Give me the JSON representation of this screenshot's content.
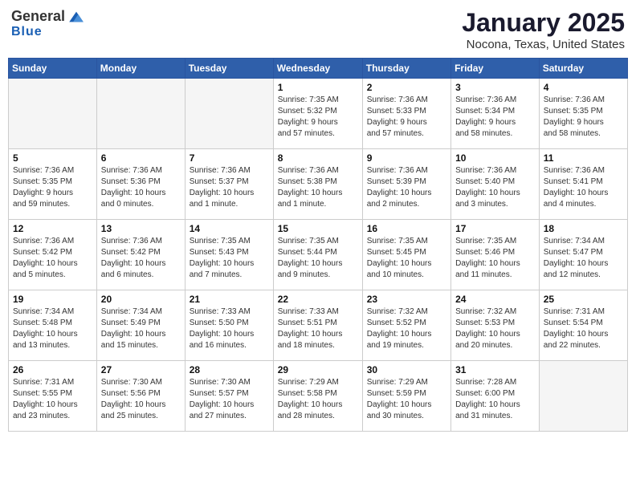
{
  "logo": {
    "general": "General",
    "blue": "Blue",
    "tagline": "Blue"
  },
  "header": {
    "title": "January 2025",
    "subtitle": "Nocona, Texas, United States"
  },
  "days_of_week": [
    "Sunday",
    "Monday",
    "Tuesday",
    "Wednesday",
    "Thursday",
    "Friday",
    "Saturday"
  ],
  "weeks": [
    [
      {
        "day": "",
        "info": ""
      },
      {
        "day": "",
        "info": ""
      },
      {
        "day": "",
        "info": ""
      },
      {
        "day": "1",
        "info": "Sunrise: 7:35 AM\nSunset: 5:32 PM\nDaylight: 9 hours\nand 57 minutes."
      },
      {
        "day": "2",
        "info": "Sunrise: 7:36 AM\nSunset: 5:33 PM\nDaylight: 9 hours\nand 57 minutes."
      },
      {
        "day": "3",
        "info": "Sunrise: 7:36 AM\nSunset: 5:34 PM\nDaylight: 9 hours\nand 58 minutes."
      },
      {
        "day": "4",
        "info": "Sunrise: 7:36 AM\nSunset: 5:35 PM\nDaylight: 9 hours\nand 58 minutes."
      }
    ],
    [
      {
        "day": "5",
        "info": "Sunrise: 7:36 AM\nSunset: 5:35 PM\nDaylight: 9 hours\nand 59 minutes."
      },
      {
        "day": "6",
        "info": "Sunrise: 7:36 AM\nSunset: 5:36 PM\nDaylight: 10 hours\nand 0 minutes."
      },
      {
        "day": "7",
        "info": "Sunrise: 7:36 AM\nSunset: 5:37 PM\nDaylight: 10 hours\nand 1 minute."
      },
      {
        "day": "8",
        "info": "Sunrise: 7:36 AM\nSunset: 5:38 PM\nDaylight: 10 hours\nand 1 minute."
      },
      {
        "day": "9",
        "info": "Sunrise: 7:36 AM\nSunset: 5:39 PM\nDaylight: 10 hours\nand 2 minutes."
      },
      {
        "day": "10",
        "info": "Sunrise: 7:36 AM\nSunset: 5:40 PM\nDaylight: 10 hours\nand 3 minutes."
      },
      {
        "day": "11",
        "info": "Sunrise: 7:36 AM\nSunset: 5:41 PM\nDaylight: 10 hours\nand 4 minutes."
      }
    ],
    [
      {
        "day": "12",
        "info": "Sunrise: 7:36 AM\nSunset: 5:42 PM\nDaylight: 10 hours\nand 5 minutes."
      },
      {
        "day": "13",
        "info": "Sunrise: 7:36 AM\nSunset: 5:42 PM\nDaylight: 10 hours\nand 6 minutes."
      },
      {
        "day": "14",
        "info": "Sunrise: 7:35 AM\nSunset: 5:43 PM\nDaylight: 10 hours\nand 7 minutes."
      },
      {
        "day": "15",
        "info": "Sunrise: 7:35 AM\nSunset: 5:44 PM\nDaylight: 10 hours\nand 9 minutes."
      },
      {
        "day": "16",
        "info": "Sunrise: 7:35 AM\nSunset: 5:45 PM\nDaylight: 10 hours\nand 10 minutes."
      },
      {
        "day": "17",
        "info": "Sunrise: 7:35 AM\nSunset: 5:46 PM\nDaylight: 10 hours\nand 11 minutes."
      },
      {
        "day": "18",
        "info": "Sunrise: 7:34 AM\nSunset: 5:47 PM\nDaylight: 10 hours\nand 12 minutes."
      }
    ],
    [
      {
        "day": "19",
        "info": "Sunrise: 7:34 AM\nSunset: 5:48 PM\nDaylight: 10 hours\nand 13 minutes."
      },
      {
        "day": "20",
        "info": "Sunrise: 7:34 AM\nSunset: 5:49 PM\nDaylight: 10 hours\nand 15 minutes."
      },
      {
        "day": "21",
        "info": "Sunrise: 7:33 AM\nSunset: 5:50 PM\nDaylight: 10 hours\nand 16 minutes."
      },
      {
        "day": "22",
        "info": "Sunrise: 7:33 AM\nSunset: 5:51 PM\nDaylight: 10 hours\nand 18 minutes."
      },
      {
        "day": "23",
        "info": "Sunrise: 7:32 AM\nSunset: 5:52 PM\nDaylight: 10 hours\nand 19 minutes."
      },
      {
        "day": "24",
        "info": "Sunrise: 7:32 AM\nSunset: 5:53 PM\nDaylight: 10 hours\nand 20 minutes."
      },
      {
        "day": "25",
        "info": "Sunrise: 7:31 AM\nSunset: 5:54 PM\nDaylight: 10 hours\nand 22 minutes."
      }
    ],
    [
      {
        "day": "26",
        "info": "Sunrise: 7:31 AM\nSunset: 5:55 PM\nDaylight: 10 hours\nand 23 minutes."
      },
      {
        "day": "27",
        "info": "Sunrise: 7:30 AM\nSunset: 5:56 PM\nDaylight: 10 hours\nand 25 minutes."
      },
      {
        "day": "28",
        "info": "Sunrise: 7:30 AM\nSunset: 5:57 PM\nDaylight: 10 hours\nand 27 minutes."
      },
      {
        "day": "29",
        "info": "Sunrise: 7:29 AM\nSunset: 5:58 PM\nDaylight: 10 hours\nand 28 minutes."
      },
      {
        "day": "30",
        "info": "Sunrise: 7:29 AM\nSunset: 5:59 PM\nDaylight: 10 hours\nand 30 minutes."
      },
      {
        "day": "31",
        "info": "Sunrise: 7:28 AM\nSunset: 6:00 PM\nDaylight: 10 hours\nand 31 minutes."
      },
      {
        "day": "",
        "info": ""
      }
    ]
  ]
}
